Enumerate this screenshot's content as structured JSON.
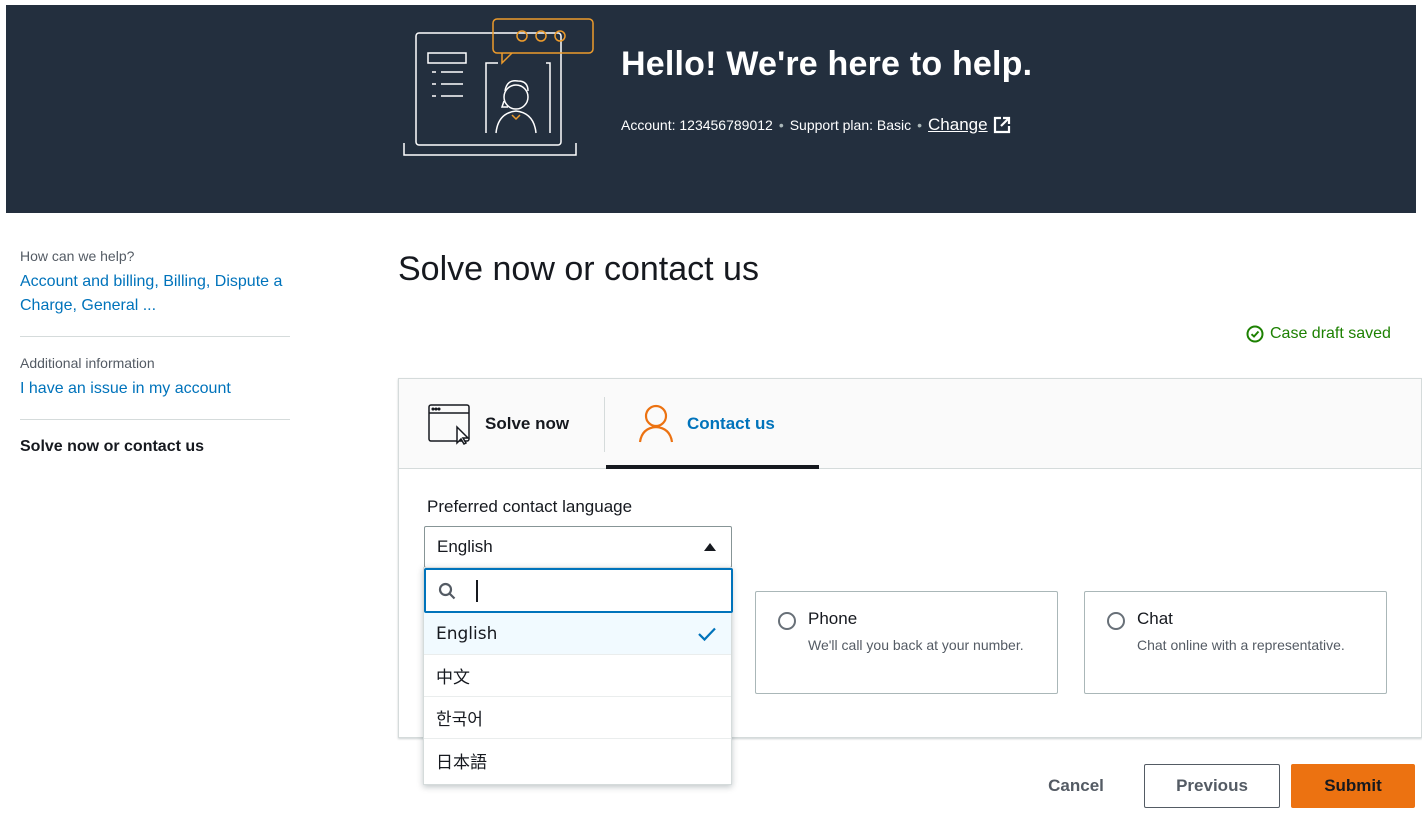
{
  "header": {
    "title": "Hello! We're here to help.",
    "account": "Account: 123456789012",
    "support_plan": "Support plan: Basic",
    "change_link": "Change",
    "illustration": "support-agent-laptop-illustration"
  },
  "sidebar": {
    "sections": [
      {
        "heading": "How can we help?",
        "value": "Account and billing, Billing, Dispute a Charge, General ..."
      },
      {
        "heading": "Additional information",
        "value": "I have an issue in my account"
      }
    ],
    "current": "Solve now or contact us"
  },
  "main": {
    "title": "Solve now or contact us",
    "status": "Case draft saved",
    "tabs": [
      {
        "label": "Solve now",
        "icon": "browser-cursor-icon"
      },
      {
        "label": "Contact us",
        "icon": "person-icon",
        "active": true
      }
    ],
    "language": {
      "label": "Preferred contact language",
      "selected": "English",
      "search_value": "",
      "options": [
        "English",
        "中文",
        "한국어",
        "日本語"
      ]
    },
    "contact_options": [
      {
        "title": "Phone",
        "description": "We'll call you back at your number."
      },
      {
        "title": "Chat",
        "description": "Chat online with a representative."
      }
    ]
  },
  "actions": {
    "cancel": "Cancel",
    "previous": "Previous",
    "submit": "Submit"
  },
  "colors": {
    "header_bg": "#232f3e",
    "link": "#0073bb",
    "success": "#1d8102",
    "primary": "#ec7211",
    "illustration_accent": "#ec9b2c"
  }
}
